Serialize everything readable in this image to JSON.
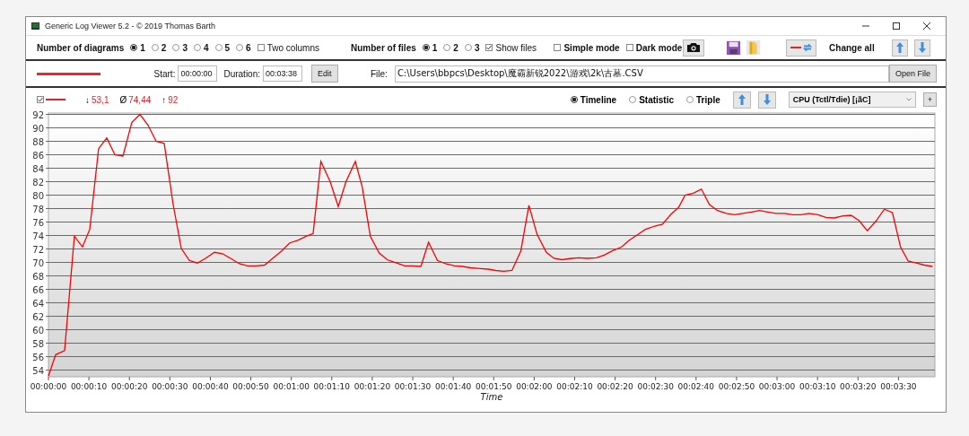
{
  "window": {
    "title": "Generic Log Viewer 5.2 - © 2019 Thomas Barth"
  },
  "toolbar": {
    "diagrams_label": "Number of diagrams",
    "diagram_options": [
      {
        "label": "1",
        "selected": true
      },
      {
        "label": "2",
        "selected": false
      },
      {
        "label": "3",
        "selected": false
      },
      {
        "label": "4",
        "selected": false
      },
      {
        "label": "5",
        "selected": false
      },
      {
        "label": "6",
        "selected": false
      }
    ],
    "two_columns": {
      "label": "Two columns",
      "checked": false
    },
    "files_label": "Number of files",
    "file_options": [
      {
        "label": "1",
        "selected": true
      },
      {
        "label": "2",
        "selected": false
      },
      {
        "label": "3",
        "selected": false
      }
    ],
    "show_files": {
      "label": "Show files",
      "checked": true
    },
    "simple_mode": {
      "label": "Simple mode",
      "checked": false
    },
    "dark_mode": {
      "label": "Dark mode",
      "checked": false
    },
    "change_all_label": "Change all"
  },
  "file_bar": {
    "start_label": "Start:",
    "start_value": "00:00:00",
    "duration_label": "Duration:",
    "duration_value": "00:03:38",
    "edit_button": "Edit",
    "file_label": "File:",
    "file_path": "C:\\Users\\bbpcs\\Desktop\\魔霸新锐2022\\游戏\\2k\\古墓.CSV",
    "open_button": "Open File"
  },
  "legend": {
    "checked": true,
    "min_symbol": "↓",
    "min": "53,1",
    "avg_symbol": "Ø",
    "avg": "74,44",
    "max_symbol": "↑",
    "max": "92"
  },
  "view_modes": [
    {
      "label": "Timeline",
      "selected": true
    },
    {
      "label": "Statistic",
      "selected": false
    },
    {
      "label": "Triple",
      "selected": false
    }
  ],
  "sensor_select": {
    "value": "CPU (Tctl/Tdie) [¡ãC]"
  },
  "add_button": "+",
  "chart_data": {
    "type": "line",
    "grid": true,
    "xlabel": "Time",
    "xlim": [
      0,
      219
    ],
    "ylim": [
      53,
      92.2
    ],
    "x": [
      0,
      1.8,
      4,
      6.4,
      8.4,
      10.2,
      12.4,
      14.4,
      16.4,
      18.4,
      20.6,
      22.6,
      24.6,
      26.6,
      28.6,
      30.8,
      32.8,
      34.8,
      36.8,
      38.8,
      41,
      43,
      45,
      47.2,
      49.2,
      51.4,
      53.4,
      55.4,
      57.6,
      59.6,
      61.6,
      63.8,
      65.4,
      67.3,
      69.6,
      71.6,
      73.5,
      75.8,
      77.5,
      79.5,
      81.7,
      83.7,
      86,
      88,
      90,
      92,
      93.9,
      96.1,
      98.1,
      100.4,
      102.3,
      104.3,
      106.6,
      108.6,
      110.5,
      112.5,
      114.5,
      116.7,
      118.7,
      120.7,
      123,
      124.9,
      126.9,
      129.2,
      131.1,
      133.1,
      135.4,
      137.3,
      139.3,
      141.6,
      143.5,
      145.5,
      147.5,
      149.8,
      151.7,
      153.7,
      155.7,
      157.3,
      159.3,
      161.3,
      163.3,
      165.3,
      167.5,
      169.5,
      171.5,
      173.7,
      175.7,
      177.7,
      179.7,
      181.9,
      183.9,
      185.9,
      187.9,
      190.1,
      192.1,
      194.1,
      196.3,
      198.3,
      200.3,
      202.3,
      204.5,
      206.5,
      208.5,
      210.5,
      212.4,
      214.4,
      216.4,
      218.4
    ],
    "series": [
      {
        "color": "#ff0000",
        "values": [
          53.1,
          56.3,
          56.9,
          73.9,
          72.3,
          74.9,
          86.9,
          88.5,
          86,
          85.8,
          90.8,
          92,
          90.4,
          88,
          87.7,
          78.6,
          72.1,
          70.3,
          69.9,
          70.6,
          71.5,
          71.3,
          70.6,
          69.8,
          69.5,
          69.5,
          69.6,
          70.6,
          71.7,
          72.9,
          73.3,
          73.9,
          74.3,
          85,
          82,
          78.3,
          82,
          85,
          81.3,
          73.9,
          71.4,
          70.4,
          69.9,
          69.5,
          69.5,
          69.4,
          73,
          70.3,
          69.8,
          69.5,
          69.4,
          69.2,
          69.1,
          69,
          68.8,
          68.7,
          68.8,
          71.7,
          78.5,
          74.2,
          71.5,
          70.6,
          70.4,
          70.6,
          70.7,
          70.6,
          70.7,
          71.1,
          71.7,
          72.3,
          73.3,
          74.1,
          74.9,
          75.4,
          75.7,
          77.1,
          78.2,
          80,
          80.3,
          80.9,
          78.6,
          77.7,
          77.3,
          77.1,
          77.3,
          77.5,
          77.7,
          77.5,
          77.3,
          77.3,
          77.1,
          77.1,
          77.3,
          77.1,
          76.7,
          76.6,
          76.9,
          77,
          76.2,
          74.7,
          76.2,
          77.9,
          77.4,
          72.3,
          70.2,
          69.9,
          69.6,
          69.4
        ]
      }
    ],
    "yticks": [
      54,
      56,
      58,
      60,
      62,
      64,
      66,
      68,
      70,
      72,
      74,
      76,
      78,
      80,
      82,
      84,
      86,
      88,
      90,
      92
    ],
    "xticks": [
      {
        "value": 0,
        "label": "00:00:00"
      },
      {
        "value": 10,
        "label": "00:00:10"
      },
      {
        "value": 20,
        "label": "00:00:20"
      },
      {
        "value": 30,
        "label": "00:00:30"
      },
      {
        "value": 40,
        "label": "00:00:40"
      },
      {
        "value": 50,
        "label": "00:00:50"
      },
      {
        "value": 60,
        "label": "00:01:00"
      },
      {
        "value": 70,
        "label": "00:01:10"
      },
      {
        "value": 80,
        "label": "00:01:20"
      },
      {
        "value": 90,
        "label": "00:01:30"
      },
      {
        "value": 100,
        "label": "00:01:40"
      },
      {
        "value": 110,
        "label": "00:01:50"
      },
      {
        "value": 120,
        "label": "00:02:00"
      },
      {
        "value": 130,
        "label": "00:02:10"
      },
      {
        "value": 140,
        "label": "00:02:20"
      },
      {
        "value": 150,
        "label": "00:02:30"
      },
      {
        "value": 160,
        "label": "00:02:40"
      },
      {
        "value": 170,
        "label": "00:02:50"
      },
      {
        "value": 180,
        "label": "00:03:00"
      },
      {
        "value": 190,
        "label": "00:03:10"
      },
      {
        "value": 200,
        "label": "00:03:20"
      },
      {
        "value": 210,
        "label": "00:03:30"
      }
    ]
  }
}
